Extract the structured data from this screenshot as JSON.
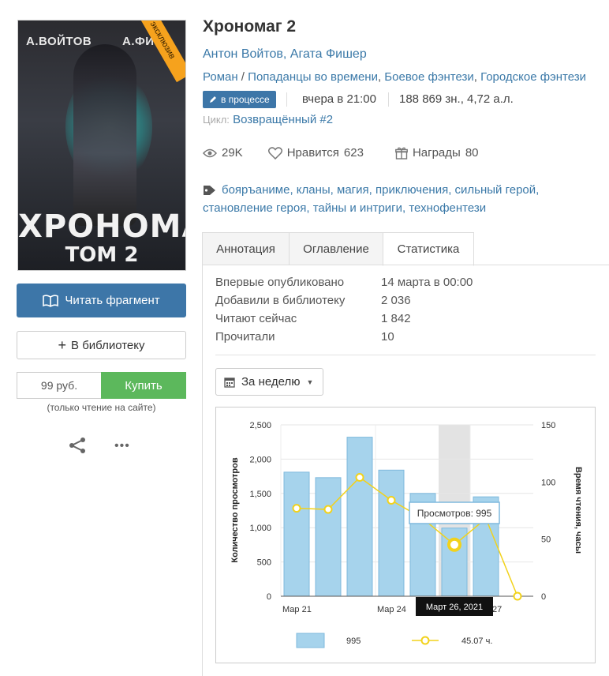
{
  "book": {
    "title": "Хрономаг 2",
    "authors": "Антон Войтов, Агата Фишер",
    "form": "Роман",
    "genres": [
      "Попаданцы во времени",
      "Боевое фэнтези",
      "Городское фэнтези"
    ],
    "status": "в процессе",
    "updated": "вчера в 21:00",
    "size": "188 869 зн., 4,72 а.л.",
    "cycle_label": "Цикл:",
    "cycle": "Возвращённый #2"
  },
  "cover": {
    "author_left": "А.ВОЙТОВ",
    "author_right": "А.ФИ",
    "title": "ХРОНОМАГ",
    "volume": "ТОМ 2",
    "badge": "эксклюзив"
  },
  "counters": {
    "views": "29K",
    "likes_label": "Нравится",
    "likes": "623",
    "awards_label": "Награды",
    "awards": "80"
  },
  "tags": [
    "бояръаниме",
    "кланы",
    "магия",
    "приключения",
    "сильный герой",
    "становление героя",
    "тайны и интриги",
    "технофентези"
  ],
  "sidebar": {
    "read_fragment": "Читать фрагмент",
    "add_library": "В библиотеку",
    "price": "99 руб.",
    "buy": "Купить",
    "note": "(только чтение на сайте)"
  },
  "tabs": [
    "Аннотация",
    "Оглавление",
    "Статистика"
  ],
  "stats": [
    {
      "label": "Впервые опубликовано",
      "value": "14 марта в 00:00"
    },
    {
      "label": "Добавили в библиотеку",
      "value": "2 036"
    },
    {
      "label": "Читают сейчас",
      "value": "1 842"
    },
    {
      "label": "Прочитали",
      "value": "10"
    }
  ],
  "period": "За неделю",
  "colors": {
    "accent": "#3d76a8",
    "buy": "#5cb85c",
    "bar": "#a6d3ec",
    "line": "#f2d21b",
    "badge": "#f6a21d"
  },
  "chart_data": {
    "type": "bar",
    "ylabel": "Количество просмотров",
    "y2label": "Время чтения, часы",
    "ylim": [
      0,
      2500
    ],
    "y2lim": [
      0,
      150
    ],
    "yticks": [
      "2,500",
      "2,000",
      "1,500",
      "1,000",
      "500",
      "0"
    ],
    "y2ticks": [
      "150",
      "100",
      "50",
      "0"
    ],
    "x_labels": [
      "Мар 21",
      "Мар 24",
      "27"
    ],
    "series": [
      {
        "name": "views",
        "values": [
          1810,
          1730,
          2320,
          1840,
          1500,
          995,
          1450
        ]
      },
      {
        "name": "reading_hours",
        "values": [
          77,
          76,
          104,
          84,
          68,
          45.07,
          68,
          0
        ]
      }
    ],
    "highlight_index": 5,
    "tooltip": "Просмотров: 995",
    "x_tooltip": "Март 26, 2021",
    "legend": [
      {
        "label": "995"
      },
      {
        "label": "45.07 ч."
      }
    ]
  }
}
